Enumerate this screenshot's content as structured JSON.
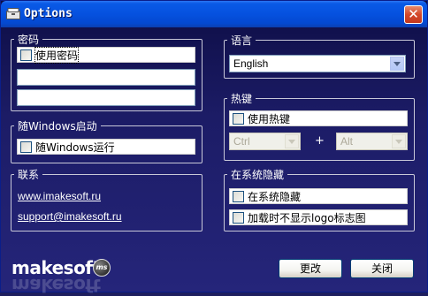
{
  "window": {
    "title": "Options",
    "close_glyph": "✕"
  },
  "password": {
    "legend": "密码",
    "use_password_label": "使用密码",
    "password_value": "",
    "confirm_value": ""
  },
  "startup": {
    "legend": "随Windows启动",
    "run_label": "随Windows运行"
  },
  "contact": {
    "legend": "联系",
    "website": "www.imakesoft.ru",
    "email": "support@imakesoft.ru"
  },
  "language": {
    "legend": "语言",
    "selected": "English"
  },
  "hotkey": {
    "legend": "热键",
    "use_hotkey_label": "使用热键",
    "modifier1": "Ctrl",
    "plus": "+",
    "modifier2": "Alt"
  },
  "tray": {
    "legend": "在系统隐藏",
    "hide_label": "在系统隐藏",
    "no_logo_label": "加载时不显示logo标志图"
  },
  "buttons": {
    "apply": "更改",
    "close": "关闭"
  },
  "logo": {
    "text": "makesoft",
    "badge": "ms"
  },
  "icons": [
    "window-app-icon",
    "close-icon",
    "dropdown-arrow-icon",
    "checkbox-icon"
  ]
}
